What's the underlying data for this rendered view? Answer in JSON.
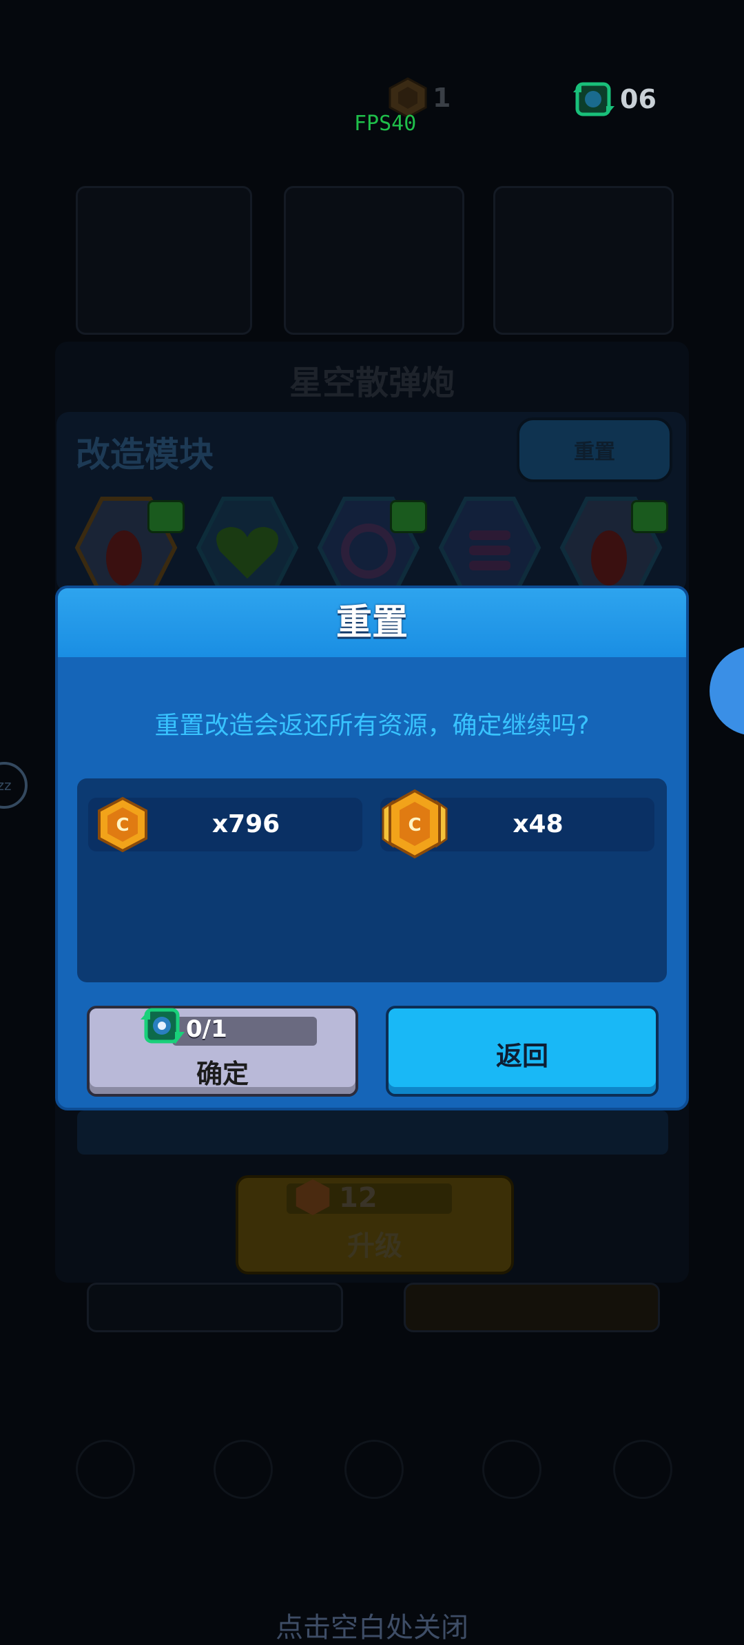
{
  "hud": {
    "badge_count": "1",
    "reset_token_count": "06",
    "fps": "FPS40"
  },
  "background": {
    "weapon_title": "星空散弹炮",
    "module_section_title": "改造模块",
    "reset_button_label": "重置",
    "upgrade_cost": "12",
    "upgrade_label": "升级"
  },
  "dialog": {
    "title": "重置",
    "message": "重置改造会返还所有资源，确定继续吗?",
    "resources": [
      {
        "icon": "gold-hex-coin-icon",
        "amount": "x796"
      },
      {
        "icon": "gold-winged-badge-icon",
        "amount": "x48"
      }
    ],
    "confirm": {
      "cost": "0/1",
      "label": "确定"
    },
    "back": {
      "label": "返回"
    }
  },
  "close_hint": "点击空白处关闭",
  "side_widget_text": "zz",
  "colors": {
    "dialog_body": "#1565b8",
    "dialog_header": "#2ea4ee",
    "message_text": "#38c3ff",
    "confirm_button": "#b9b9d8",
    "back_button": "#19b8f6",
    "coin_gold": "#f2a31a"
  }
}
